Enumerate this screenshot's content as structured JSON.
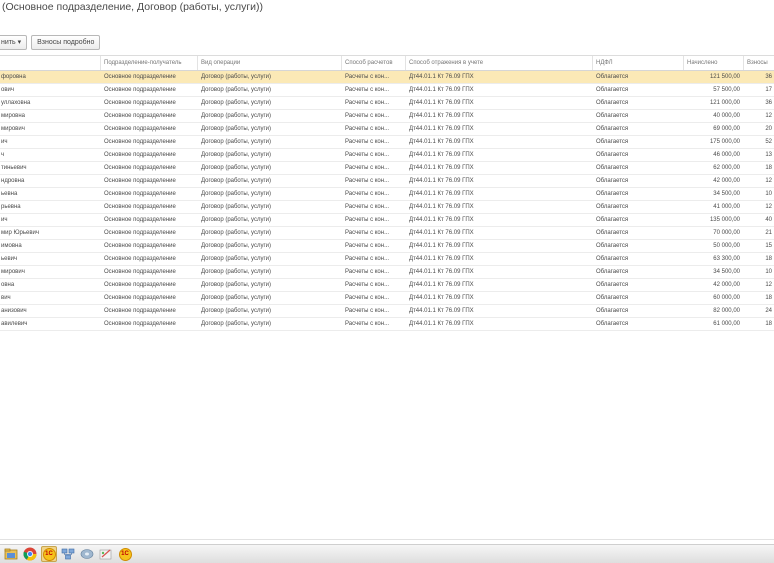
{
  "title": "(Основное подразделение, Договор (работы, услуги))",
  "toolbar": {
    "fill_label": "нить ▾",
    "details_label": "Взносы подробно"
  },
  "columns": {
    "person": "",
    "department": "Подразделение-получатель",
    "operation": "Вид операции",
    "payment_method": "Способ расчетов",
    "accounting": "Способ отражения в учете",
    "ndfl": "НДФЛ",
    "accrued": "Начислено",
    "contributions": "Взносы"
  },
  "rows": [
    {
      "person": "форовна",
      "department": "Основное подразделение",
      "operation": "Договор (работы, услуги)",
      "payment_method": "Расчеты с кон...",
      "accounting": "Дт44.01.1  Кт 76.09  ГПХ",
      "ndfl": "Облагается",
      "accrued": "121 500,00",
      "contributions": "36"
    },
    {
      "person": "ович",
      "department": "Основное подразделение",
      "operation": "Договор (работы, услуги)",
      "payment_method": "Расчеты с кон...",
      "accounting": "Дт44.01.1  Кт 76.09  ГПХ",
      "ndfl": "Облагается",
      "accrued": "57 500,00",
      "contributions": "17"
    },
    {
      "person": "уллаховна",
      "department": "Основное подразделение",
      "operation": "Договор (работы, услуги)",
      "payment_method": "Расчеты с кон...",
      "accounting": "Дт44.01.1  Кт 76.09  ГПХ",
      "ndfl": "Облагается",
      "accrued": "121 000,00",
      "contributions": "36"
    },
    {
      "person": "мировна",
      "department": "Основное подразделение",
      "operation": "Договор (работы, услуги)",
      "payment_method": "Расчеты с кон...",
      "accounting": "Дт44.01.1  Кт 76.09  ГПХ",
      "ndfl": "Облагается",
      "accrued": "40 000,00",
      "contributions": "12"
    },
    {
      "person": "мирович",
      "department": "Основное подразделение",
      "operation": "Договор (работы, услуги)",
      "payment_method": "Расчеты с кон...",
      "accounting": "Дт44.01.1  Кт 76.09  ГПХ",
      "ndfl": "Облагается",
      "accrued": "69 000,00",
      "contributions": "20"
    },
    {
      "person": "ич",
      "department": "Основное подразделение",
      "operation": "Договор (работы, услуги)",
      "payment_method": "Расчеты с кон...",
      "accounting": "Дт44.01.1  Кт 76.09  ГПХ",
      "ndfl": "Облагается",
      "accrued": "175 000,00",
      "contributions": "52"
    },
    {
      "person": "ч",
      "department": "Основное подразделение",
      "operation": "Договор (работы, услуги)",
      "payment_method": "Расчеты с кон...",
      "accounting": "Дт44.01.1  Кт 76.09  ГПХ",
      "ndfl": "Облагается",
      "accrued": "46 000,00",
      "contributions": "13"
    },
    {
      "person": "тиньевич",
      "department": "Основное подразделение",
      "operation": "Договор (работы, услуги)",
      "payment_method": "Расчеты с кон...",
      "accounting": "Дт44.01.1  Кт 76.09  ГПХ",
      "ndfl": "Облагается",
      "accrued": "62 000,00",
      "contributions": "18"
    },
    {
      "person": "ндровна",
      "department": "Основное подразделение",
      "operation": "Договор (работы, услуги)",
      "payment_method": "Расчеты с кон...",
      "accounting": "Дт44.01.1  Кт 76.09  ГПХ",
      "ndfl": "Облагается",
      "accrued": "42 000,00",
      "contributions": "12"
    },
    {
      "person": "ьевна",
      "department": "Основное подразделение",
      "operation": "Договор (работы, услуги)",
      "payment_method": "Расчеты с кон...",
      "accounting": "Дт44.01.1  Кт 76.09  ГПХ",
      "ndfl": "Облагается",
      "accrued": "34 500,00",
      "contributions": "10"
    },
    {
      "person": "рьевна",
      "department": "Основное подразделение",
      "operation": "Договор (работы, услуги)",
      "payment_method": "Расчеты с кон...",
      "accounting": "Дт44.01.1  Кт 76.09  ГПХ",
      "ndfl": "Облагается",
      "accrued": "41 000,00",
      "contributions": "12"
    },
    {
      "person": "ич",
      "department": "Основное подразделение",
      "operation": "Договор (работы, услуги)",
      "payment_method": "Расчеты с кон...",
      "accounting": "Дт44.01.1  Кт 76.09  ГПХ",
      "ndfl": "Облагается",
      "accrued": "135 000,00",
      "contributions": "40"
    },
    {
      "person": "мир Юрьевич",
      "department": "Основное подразделение",
      "operation": "Договор (работы, услуги)",
      "payment_method": "Расчеты с кон...",
      "accounting": "Дт44.01.1  Кт 76.09  ГПХ",
      "ndfl": "Облагается",
      "accrued": "70 000,00",
      "contributions": "21"
    },
    {
      "person": "имовна",
      "department": "Основное подразделение",
      "operation": "Договор (работы, услуги)",
      "payment_method": "Расчеты с кон...",
      "accounting": "Дт44.01.1  Кт 76.09  ГПХ",
      "ndfl": "Облагается",
      "accrued": "50 000,00",
      "contributions": "15"
    },
    {
      "person": "ьевич",
      "department": "Основное подразделение",
      "operation": "Договор (работы, услуги)",
      "payment_method": "Расчеты с кон...",
      "accounting": "Дт44.01.1  Кт 76.09  ГПХ",
      "ndfl": "Облагается",
      "accrued": "63 300,00",
      "contributions": "18"
    },
    {
      "person": "мирович",
      "department": "Основное подразделение",
      "operation": "Договор (работы, услуги)",
      "payment_method": "Расчеты с кон...",
      "accounting": "Дт44.01.1  Кт 76.09  ГПХ",
      "ndfl": "Облагается",
      "accrued": "34 500,00",
      "contributions": "10"
    },
    {
      "person": "овна",
      "department": "Основное подразделение",
      "operation": "Договор (работы, услуги)",
      "payment_method": "Расчеты с кон...",
      "accounting": "Дт44.01.1  Кт 76.09  ГПХ",
      "ndfl": "Облагается",
      "accrued": "42 000,00",
      "contributions": "12"
    },
    {
      "person": "вич",
      "department": "Основное подразделение",
      "operation": "Договор (работы, услуги)",
      "payment_method": "Расчеты с кон...",
      "accounting": "Дт44.01.1  Кт 76.09  ГПХ",
      "ndfl": "Облагается",
      "accrued": "60 000,00",
      "contributions": "18"
    },
    {
      "person": "анизович",
      "department": "Основное подразделение",
      "operation": "Договор (работы, услуги)",
      "payment_method": "Расчеты с кон...",
      "accounting": "Дт44.01.1  Кт 76.09  ГПХ",
      "ndfl": "Облагается",
      "accrued": "82 000,00",
      "contributions": "24"
    },
    {
      "person": "авилевич",
      "department": "Основное подразделение",
      "operation": "Договор (работы, услуги)",
      "payment_method": "Расчеты с кон...",
      "accounting": "Дт44.01.1  Кт 76.09  ГПХ",
      "ndfl": "Облагается",
      "accrued": "61 000,00",
      "contributions": "18"
    }
  ],
  "taskbar": {
    "icons": [
      "windows-explorer-icon",
      "chrome-icon",
      "1c-enterprise-icon",
      "network-icon",
      "disk-tool-icon",
      "paint-icon",
      "1c-enterprise-icon"
    ],
    "onec_label": "1С"
  },
  "colors": {
    "selected_row": "#fbe9b6",
    "header_text": "#777777"
  }
}
